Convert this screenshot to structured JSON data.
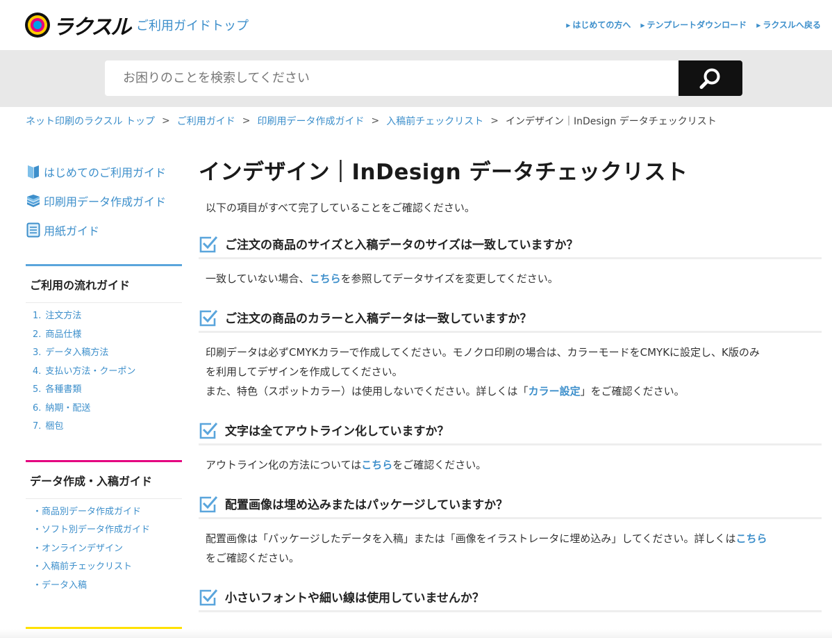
{
  "header": {
    "logo_text": "ラクスル",
    "guide_top": "ご利用ガイドトップ",
    "links": [
      "はじめての方へ",
      "テンプレートダウンロード",
      "ラクスルへ戻る"
    ]
  },
  "search": {
    "placeholder": "お困りのことを検索してください"
  },
  "breadcrumb": {
    "items": [
      "ネット印刷のラクスル トップ",
      "ご利用ガイド",
      "印刷用データ作成ガイド",
      "入稿前チェックリスト"
    ],
    "current": "インデザイン｜InDesign データチェックリスト"
  },
  "sidebar": {
    "nav": [
      "はじめてのご利用ガイド",
      "印刷用データ作成ガイド",
      "用紙ガイド"
    ],
    "flow": {
      "title": "ご利用の流れガイド",
      "items": [
        {
          "num": "1.",
          "label": "注文方法"
        },
        {
          "num": "2.",
          "label": "商品仕様"
        },
        {
          "num": "3.",
          "label": "データ入稿方法"
        },
        {
          "num": "4.",
          "label": "支払い方法・クーポン"
        },
        {
          "num": "5.",
          "label": "各種書類"
        },
        {
          "num": "6.",
          "label": "納期・配送"
        },
        {
          "num": "7.",
          "label": "梱包"
        }
      ]
    },
    "data": {
      "title": "データ作成・入稿ガイド",
      "items": [
        "・商品別データ作成ガイド",
        "・ソフト別データ作成ガイド",
        "・オンラインデザイン",
        "・入稿前チェックリスト",
        "・データ入稿"
      ]
    }
  },
  "main": {
    "title": "インデザイン｜InDesign データチェックリスト",
    "intro": "以下の項目がすべて完了していることをご確認ください。",
    "q1": {
      "title": "ご注文の商品のサイズと入稿データのサイズは一致していますか？",
      "pre": "一致していない場合、",
      "link": "こちら",
      "post": "を参照してデータサイズを変更してください。"
    },
    "q2": {
      "title": "ご注文の商品のカラーと入稿データは一致していますか？",
      "line1": "印刷データは必ずCMYKカラーで作成してください。モノクロ印刷の場合は、カラーモードをCMYKに設定し、K版のみ",
      "line2": "を利用してデザインを作成してください。",
      "line3_pre": "また、特色（スポットカラー）は使用しないでください。詳しくは「",
      "line3_link": "カラー設定",
      "line3_post": "」をご確認ください。"
    },
    "q3": {
      "title": "文字は全てアウトライン化していますか？",
      "pre": "アウトライン化の方法については",
      "link": "こちら",
      "post": "をご確認ください。"
    },
    "q4": {
      "title": "配置画像は埋め込みまたはパッケージしていますか？",
      "pre": "配置画像は「パッケージしたデータを入稿」または「画像をイラストレータに埋め込み」してください。詳しくは",
      "link": "こちら",
      "post": "をご確認ください。"
    },
    "q5": {
      "title": "小さいフォントや細い線は使用していませんか？"
    }
  },
  "colors": {
    "link": "#3d8fcb",
    "flow_border": "#5aa5dc",
    "data_border": "#e4007f",
    "bottom_border": "#ffe100"
  }
}
